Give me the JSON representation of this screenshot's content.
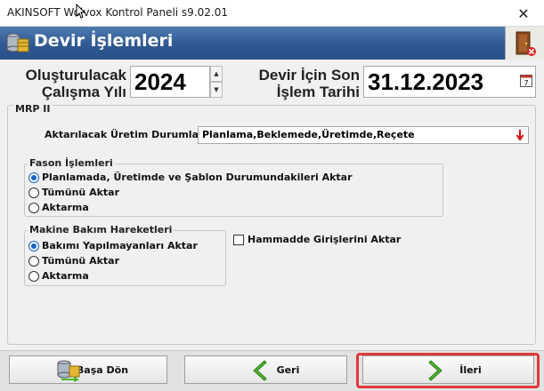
{
  "window": {
    "title": "AKINSOFT Wolvox Kontrol Paneli s9.02.01",
    "close_glyph": "✕"
  },
  "header": {
    "title": "Devir İşlemleri"
  },
  "top": {
    "year_label_1": "Oluşturulacak",
    "year_label_2": "Çalışma Yılı",
    "year_value": "2024",
    "date_label_1": "Devir İçin Son",
    "date_label_2": "İşlem Tarihi",
    "date_value": "31.12.2023",
    "calendar_icon_text": "7"
  },
  "mrp": {
    "group_title": "MRP II",
    "production_label": "Aktarılacak Üretim Durumları",
    "production_value": "Planlama,Beklemede,Üretimde,Reçete",
    "fason": {
      "title": "Fason İşlemleri",
      "options": [
        {
          "label": "Planlamada, Üretimde ve Şablon Durumundakileri Aktar",
          "selected": true
        },
        {
          "label": "Tümünü Aktar",
          "selected": false
        },
        {
          "label": "Aktarma",
          "selected": false
        }
      ]
    },
    "makine": {
      "title": "Makine Bakım Hareketleri",
      "options": [
        {
          "label": "Bakımı Yapılmayanları Aktar",
          "selected": true
        },
        {
          "label": "Tümünü Aktar",
          "selected": false
        },
        {
          "label": "Aktarma",
          "selected": false
        }
      ]
    },
    "hammadde_label": "Hammadde Girişlerini Aktar",
    "hammadde_checked": false
  },
  "buttons": {
    "home": "Başa Dön",
    "back": "Geri",
    "next": "İleri"
  },
  "colors": {
    "header": "#2f5891",
    "highlight": "#e0393a",
    "arrow_green": "#4fb82e",
    "radio_accent": "#1463c8"
  }
}
